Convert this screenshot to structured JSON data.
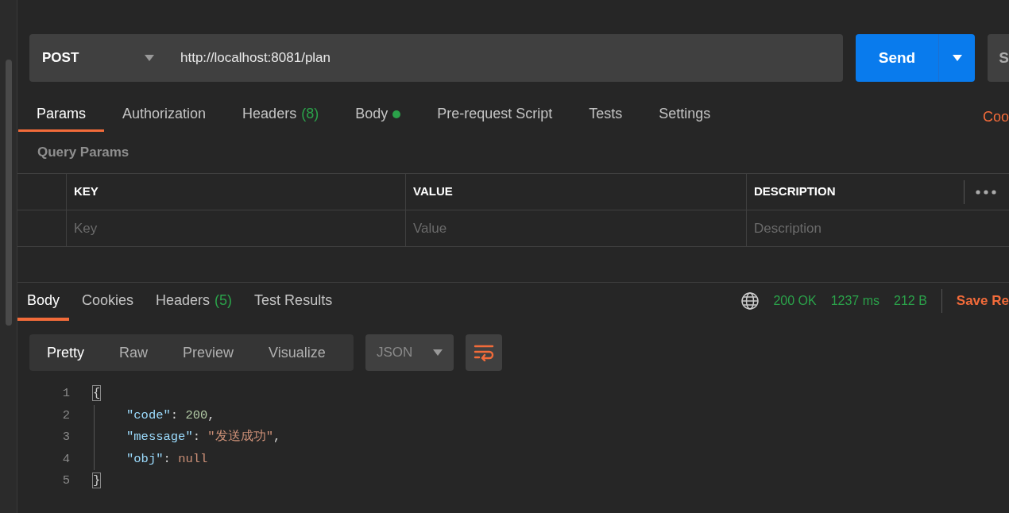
{
  "request": {
    "method": "POST",
    "url": "http://localhost:8081/plan",
    "send_label": "Send",
    "save_label_partial": "S"
  },
  "request_tabs": [
    {
      "label": "Params",
      "dot": false,
      "selected": true
    },
    {
      "label": "Authorization",
      "dot": false,
      "selected": false
    },
    {
      "label": "Headers",
      "count": "(8)",
      "dot": false,
      "selected": false
    },
    {
      "label": "Body",
      "dot": true,
      "selected": false
    },
    {
      "label": "Pre-request Script",
      "dot": false,
      "selected": false
    },
    {
      "label": "Tests",
      "dot": false,
      "selected": false
    },
    {
      "label": "Settings",
      "dot": false,
      "selected": false
    }
  ],
  "code_link": "Coo",
  "query_params": {
    "title": "Query Params",
    "columns": [
      "KEY",
      "VALUE",
      "DESCRIPTION"
    ],
    "placeholders": [
      "Key",
      "Value",
      "Description"
    ]
  },
  "response_tabs": [
    {
      "label": "Body",
      "selected": true
    },
    {
      "label": "Cookies",
      "selected": false
    },
    {
      "label": "Headers",
      "count": "(5)",
      "selected": false
    },
    {
      "label": "Test Results",
      "selected": false
    }
  ],
  "status": {
    "code": "200 OK",
    "time": "1237 ms",
    "size": "212 B",
    "save_label": "Save Re"
  },
  "view_modes": [
    {
      "label": "Pretty",
      "selected": true
    },
    {
      "label": "Raw",
      "selected": false
    },
    {
      "label": "Preview",
      "selected": false
    },
    {
      "label": "Visualize",
      "selected": false
    }
  ],
  "format": "JSON",
  "code_lines": [
    {
      "number": "1",
      "indented": false,
      "tokens": [
        {
          "kind": "bracket",
          "text": "{",
          "highlighted": true
        }
      ]
    },
    {
      "number": "2",
      "indented": true,
      "tokens": [
        {
          "kind": "key",
          "text": "\"code\""
        },
        {
          "kind": "punct",
          "text": ": "
        },
        {
          "kind": "number",
          "text": "200"
        },
        {
          "kind": "punct",
          "text": ","
        }
      ]
    },
    {
      "number": "3",
      "indented": true,
      "tokens": [
        {
          "kind": "key",
          "text": "\"message\""
        },
        {
          "kind": "punct",
          "text": ": "
        },
        {
          "kind": "string",
          "text": "\"发送成功\""
        },
        {
          "kind": "punct",
          "text": ","
        }
      ]
    },
    {
      "number": "4",
      "indented": true,
      "tokens": [
        {
          "kind": "key",
          "text": "\"obj\""
        },
        {
          "kind": "punct",
          "text": ": "
        },
        {
          "kind": "null",
          "text": "null"
        }
      ]
    },
    {
      "number": "5",
      "indented": false,
      "tokens": [
        {
          "kind": "bracket",
          "text": "}",
          "highlighted": true
        }
      ]
    }
  ]
}
